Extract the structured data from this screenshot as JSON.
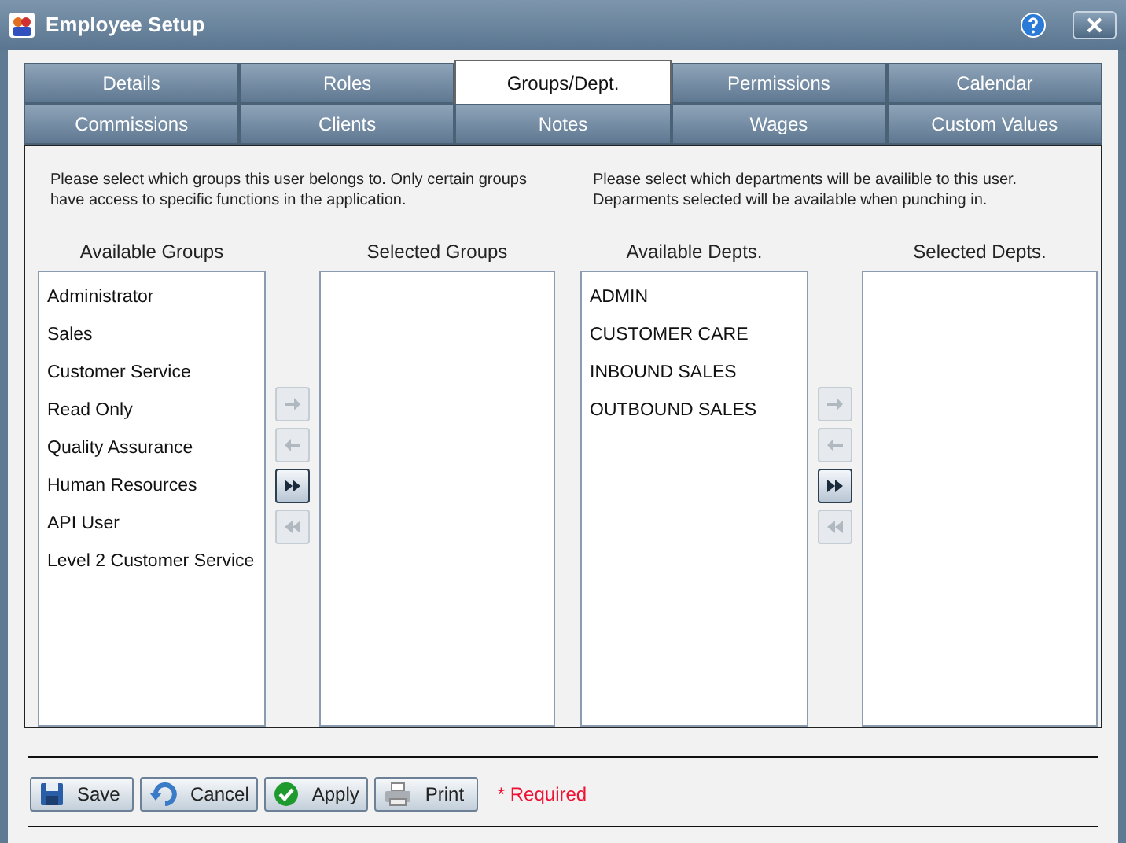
{
  "window": {
    "title": "Employee Setup"
  },
  "tab_rows": [
    [
      {
        "label": "Details",
        "selected": false
      },
      {
        "label": "Roles",
        "selected": false
      },
      {
        "label": "Groups/Dept.",
        "selected": true
      },
      {
        "label": "Permissions",
        "selected": false
      },
      {
        "label": "Calendar",
        "selected": false
      }
    ],
    [
      {
        "label": "Commissions",
        "selected": false
      },
      {
        "label": "Clients",
        "selected": false
      },
      {
        "label": "Notes",
        "selected": false
      },
      {
        "label": "Wages",
        "selected": false
      },
      {
        "label": "Custom Values",
        "selected": false
      }
    ]
  ],
  "sections": [
    {
      "description": "Please select which groups this user belongs to. Only certain groups have access to specific functions in the application.",
      "available_label": "Available Groups",
      "available": [
        "Administrator",
        "Sales",
        "Customer Service",
        "Read Only",
        "Quality Assurance",
        "Human Resources",
        "API User",
        "Level 2 Customer Service"
      ],
      "selected_label": "Selected Groups",
      "arrows": [
        {
          "kind": "right",
          "disabled": true
        },
        {
          "kind": "left",
          "disabled": true
        },
        {
          "kind": "all_right",
          "disabled": false
        },
        {
          "kind": "all_left",
          "disabled": true
        }
      ]
    },
    {
      "description": "Please select which departments will be availible to this user. Deparments selected will be available when punching in.",
      "available_label": "Available Depts.",
      "available": [
        "ADMIN",
        "CUSTOMER CARE",
        "INBOUND SALES",
        "OUTBOUND SALES"
      ],
      "selected_label": "Selected Depts.",
      "arrows": [
        {
          "kind": "right",
          "disabled": true
        },
        {
          "kind": "left",
          "disabled": true
        },
        {
          "kind": "all_right",
          "disabled": false
        },
        {
          "kind": "all_left",
          "disabled": true
        }
      ]
    }
  ],
  "footer": {
    "buttons": [
      {
        "kind": "save",
        "label": "Save"
      },
      {
        "kind": "cancel",
        "label": "Cancel"
      },
      {
        "kind": "apply",
        "label": "Apply"
      },
      {
        "kind": "print",
        "label": "Print"
      }
    ],
    "required_note": "* Required"
  }
}
